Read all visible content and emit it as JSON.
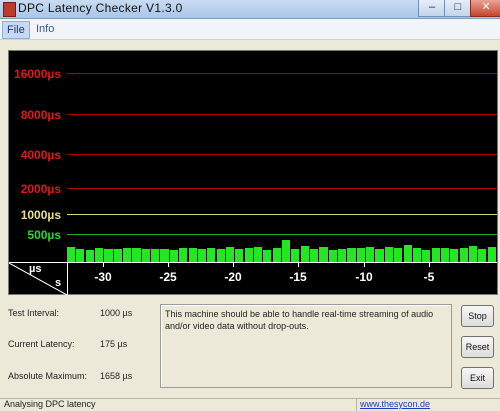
{
  "window": {
    "title": "DPC Latency Checker V1.3.0",
    "minimize_glyph": "–",
    "maximize_glyph": "□",
    "close_glyph": "✕"
  },
  "menu": {
    "file": "File",
    "info": "Info"
  },
  "graph": {
    "y_labels": {
      "l16000": "16000µs",
      "l8000": "8000µs",
      "l4000": "4000µs",
      "l2000": "2000µs",
      "l1000": "1000µs",
      "l500": "500µs"
    },
    "axis_y_unit": "µs",
    "axis_x_unit": "s",
    "x_labels": [
      "-30",
      "-25",
      "-20",
      "-15",
      "-10",
      "-5"
    ],
    "colors": {
      "high": "#b40000",
      "medium": "#d8d26a",
      "low": "#1aa81a",
      "bars": "#22e822"
    }
  },
  "chart_data": {
    "type": "bar",
    "x_unit": "s",
    "y_unit": "µs",
    "y_scale": "log-like stepped",
    "y_ticks": [
      500,
      1000,
      2000,
      4000,
      8000,
      16000
    ],
    "x_ticks": [
      -30,
      -25,
      -20,
      -15,
      -10,
      -5
    ],
    "values_us": [
      290,
      250,
      240,
      260,
      250,
      250,
      270,
      260,
      250,
      250,
      250,
      240,
      270,
      260,
      250,
      270,
      250,
      280,
      250,
      260,
      280,
      240,
      260,
      410,
      250,
      310,
      250,
      280,
      240,
      250,
      260,
      270,
      280,
      250,
      290,
      260,
      330,
      260,
      240,
      260,
      270,
      250,
      270,
      300,
      250,
      280
    ]
  },
  "stats": {
    "test_interval_label": "Test Interval:",
    "test_interval_value": "1000 µs",
    "current_latency_label": "Current Latency:",
    "current_latency_value": "175 µs",
    "absolute_maximum_label": "Absolute Maximum:",
    "absolute_maximum_value": "1658 µs"
  },
  "message": "This machine should be able to handle real-time streaming of audio and/or video data without drop-outs.",
  "buttons": {
    "stop": "Stop",
    "reset": "Reset",
    "exit": "Exit"
  },
  "status": {
    "left": "Analysing DPC latency",
    "link": "www.thesycon.de"
  }
}
